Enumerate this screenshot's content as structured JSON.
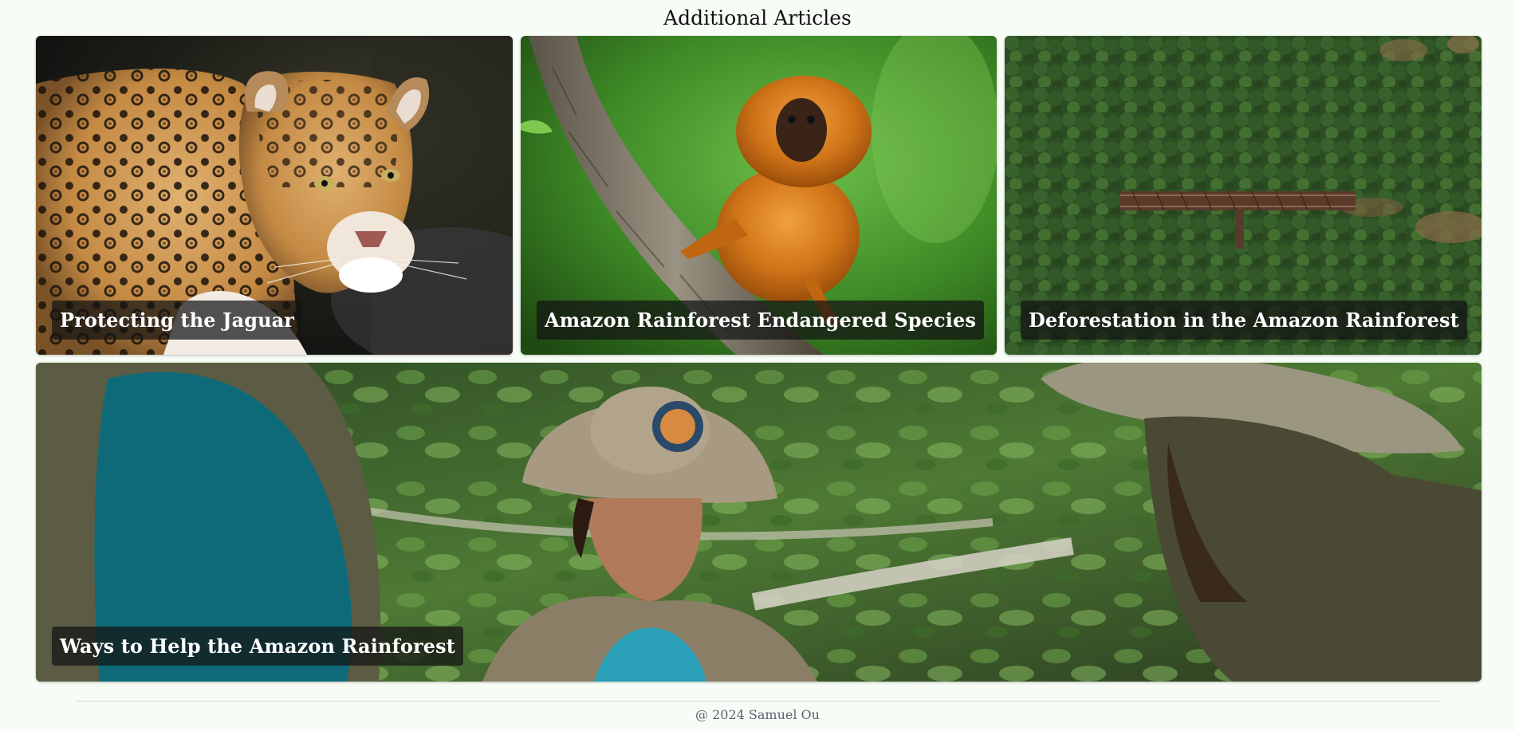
{
  "section": {
    "title": "Additional Articles"
  },
  "articles": [
    {
      "title": "Protecting the Jaguar",
      "image": "jaguar-photo"
    },
    {
      "title": "Amazon Rainforest Endangered Species",
      "image": "golden-lion-tamarin-photo"
    },
    {
      "title": "Deforestation in the Amazon Rainforest",
      "image": "aerial-forest-bridge-photo"
    },
    {
      "title": "Ways to Help the Amazon Rainforest",
      "image": "field-researchers-photo"
    }
  ],
  "footer": {
    "copyright": "@ 2024 Samuel Ou"
  }
}
